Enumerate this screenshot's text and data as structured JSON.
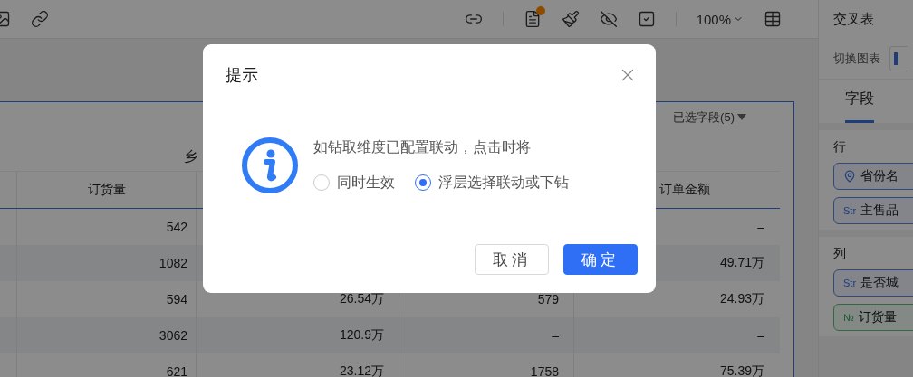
{
  "toolbar": {
    "left": [
      {
        "kind": "image"
      },
      {
        "kind": "link"
      }
    ],
    "right": [
      {
        "kind": "link-filter"
      },
      {
        "kind": "divider"
      },
      {
        "kind": "document",
        "dot": true
      },
      {
        "kind": "brush"
      },
      {
        "kind": "eye-off"
      },
      {
        "kind": "check-square"
      },
      {
        "kind": "divider"
      },
      {
        "kind": "zoom",
        "label": "100%"
      },
      {
        "kind": "table"
      }
    ]
  },
  "table": {
    "fields_button": "已选字段(5)",
    "group_header": "乡",
    "columns": [
      {
        "label": "订货量"
      },
      null,
      null,
      {
        "label": "订单金额"
      }
    ],
    "rows": [
      [
        "542",
        null,
        null,
        "–"
      ],
      [
        "1082",
        null,
        null,
        "49.71万"
      ],
      [
        "594",
        "26.54万",
        "579",
        "24.93万"
      ],
      [
        "3062",
        "120.9万",
        "–",
        "–"
      ],
      [
        "621",
        "23.12万",
        "1758",
        "75.39万"
      ]
    ]
  },
  "panel": {
    "title": "交叉表",
    "switch_label": "切换图表",
    "tabs": [
      {
        "label": "字段",
        "selected": true
      }
    ],
    "sections": [
      {
        "title": "行",
        "fields": [
          {
            "kind": "geo",
            "label": "省份名"
          },
          {
            "kind": "string",
            "tag": "Str",
            "label": "主售品"
          }
        ]
      },
      {
        "title": "列",
        "fields": [
          {
            "kind": "string",
            "tag": "Str",
            "label": "是否城"
          },
          {
            "kind": "number",
            "tag": "№",
            "label": "订货量"
          }
        ]
      }
    ]
  },
  "dialog": {
    "title": "提示",
    "message": "如钻取维度已配置联动，点击时将",
    "options": [
      {
        "label": "同时生效",
        "selected": false
      },
      {
        "label": "浮层选择联动或下钻",
        "selected": true
      }
    ],
    "buttons": [
      {
        "kind": "secondary",
        "label": "取消"
      },
      {
        "kind": "primary",
        "label": "确定"
      }
    ]
  }
}
